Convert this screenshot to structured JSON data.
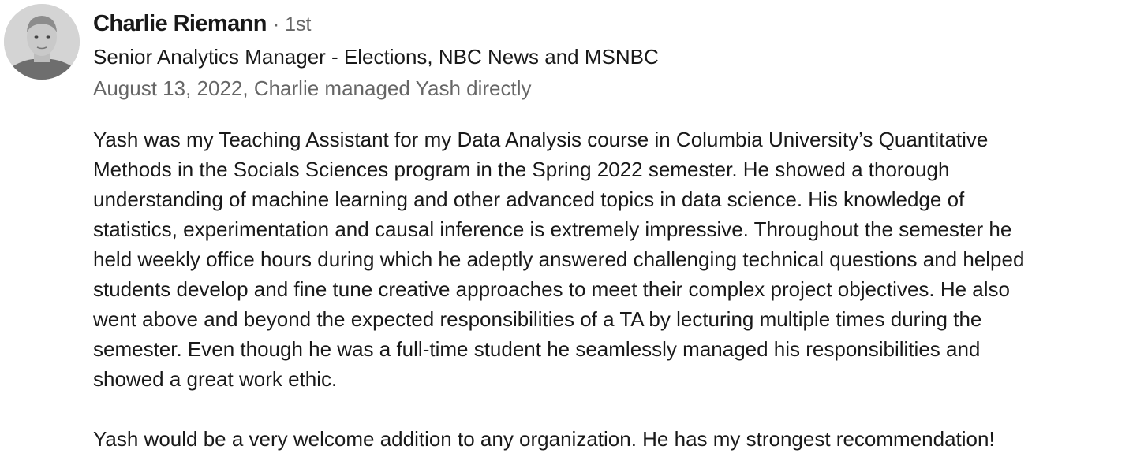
{
  "recommendation": {
    "author": {
      "name": "Charlie Riemann",
      "connection_degree": "· 1st",
      "headline": "Senior Analytics Manager - Elections, NBC News and MSNBC",
      "meta": "August 13, 2022, Charlie managed Yash directly",
      "avatar_icon": "profile-photo"
    },
    "paragraphs": [
      {
        "lines": [
          "Yash was my Teaching Assistant for my Data Analysis course in Columbia University’s Quantitative",
          "Methods in the Socials Sciences program in the Spring 2022 semester. He showed a thorough",
          "understanding of machine learning and other advanced topics in data science. His knowledge of",
          "statistics, experimentation and causal inference is extremely impressive. Throughout the semester he",
          "held weekly office hours during which he adeptly answered challenging technical questions and helped",
          "students develop and fine tune creative approaches to meet their complex project objectives. He also",
          "went above and beyond the expected responsibilities of a TA by lecturing multiple times during the",
          "semester. Even though he was a full-time student he seamlessly managed his responsibilities and",
          "showed a great work ethic."
        ]
      },
      {
        "lines": [
          "Yash would be a very welcome addition to any organization. He has my strongest recommendation!"
        ]
      }
    ]
  }
}
